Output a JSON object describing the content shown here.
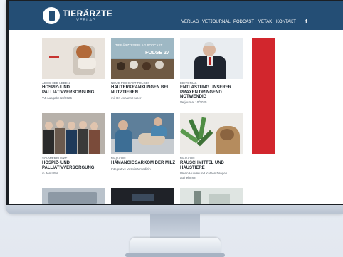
{
  "logo": {
    "title": "TIERÄRZTE",
    "subtitle": "VERLAG"
  },
  "nav": [
    "VERLAG",
    "VETJOURNAL",
    "PODCAST",
    "VETAK",
    "KONTAKT"
  ],
  "social": {
    "facebook": "f"
  },
  "podcast_thumb": {
    "title": "TIERÄRZTEVERLAG PODCAST",
    "episode": "FOLGE 27"
  },
  "cards": [
    {
      "kicker": "ABSCHIED LEBEN",
      "title": "HOSPIZ- UND PALLIATIVVERSORGUNG",
      "sub": "VJ-Ausgabe 10/2025"
    },
    {
      "kicker": "NEUE PODCAST FOLGE!",
      "title": "HAUTERKRANKUNGEN BEI NUTZTIEREN",
      "sub": "mit Dr. Johann Huber"
    },
    {
      "kicker": "EDITORIAL",
      "title": "ENTLASTUNG UNSERER PRAXEN DRINGEND NOTWENDIG",
      "sub": "Vetjournal 10/2025"
    },
    {
      "kicker": "SCHWERPUNKT",
      "title": "HOSPIZ- UND PALLIATIVVERSORGUNG",
      "sub": "in den USA"
    },
    {
      "kicker": "MAGAZIN",
      "title": "HÄMANGIOSARKOM DER MILZ",
      "sub": "Integrative Veterinärmedizin"
    },
    {
      "kicker": "MAGAZIN",
      "title": "RAUSCHMITTEL UND HAUSTIERE",
      "sub": "Wenn Hunde und Katzen Drogen aufnehmen"
    }
  ],
  "colors": {
    "header": "#244e75",
    "ad": "#d2262d"
  }
}
